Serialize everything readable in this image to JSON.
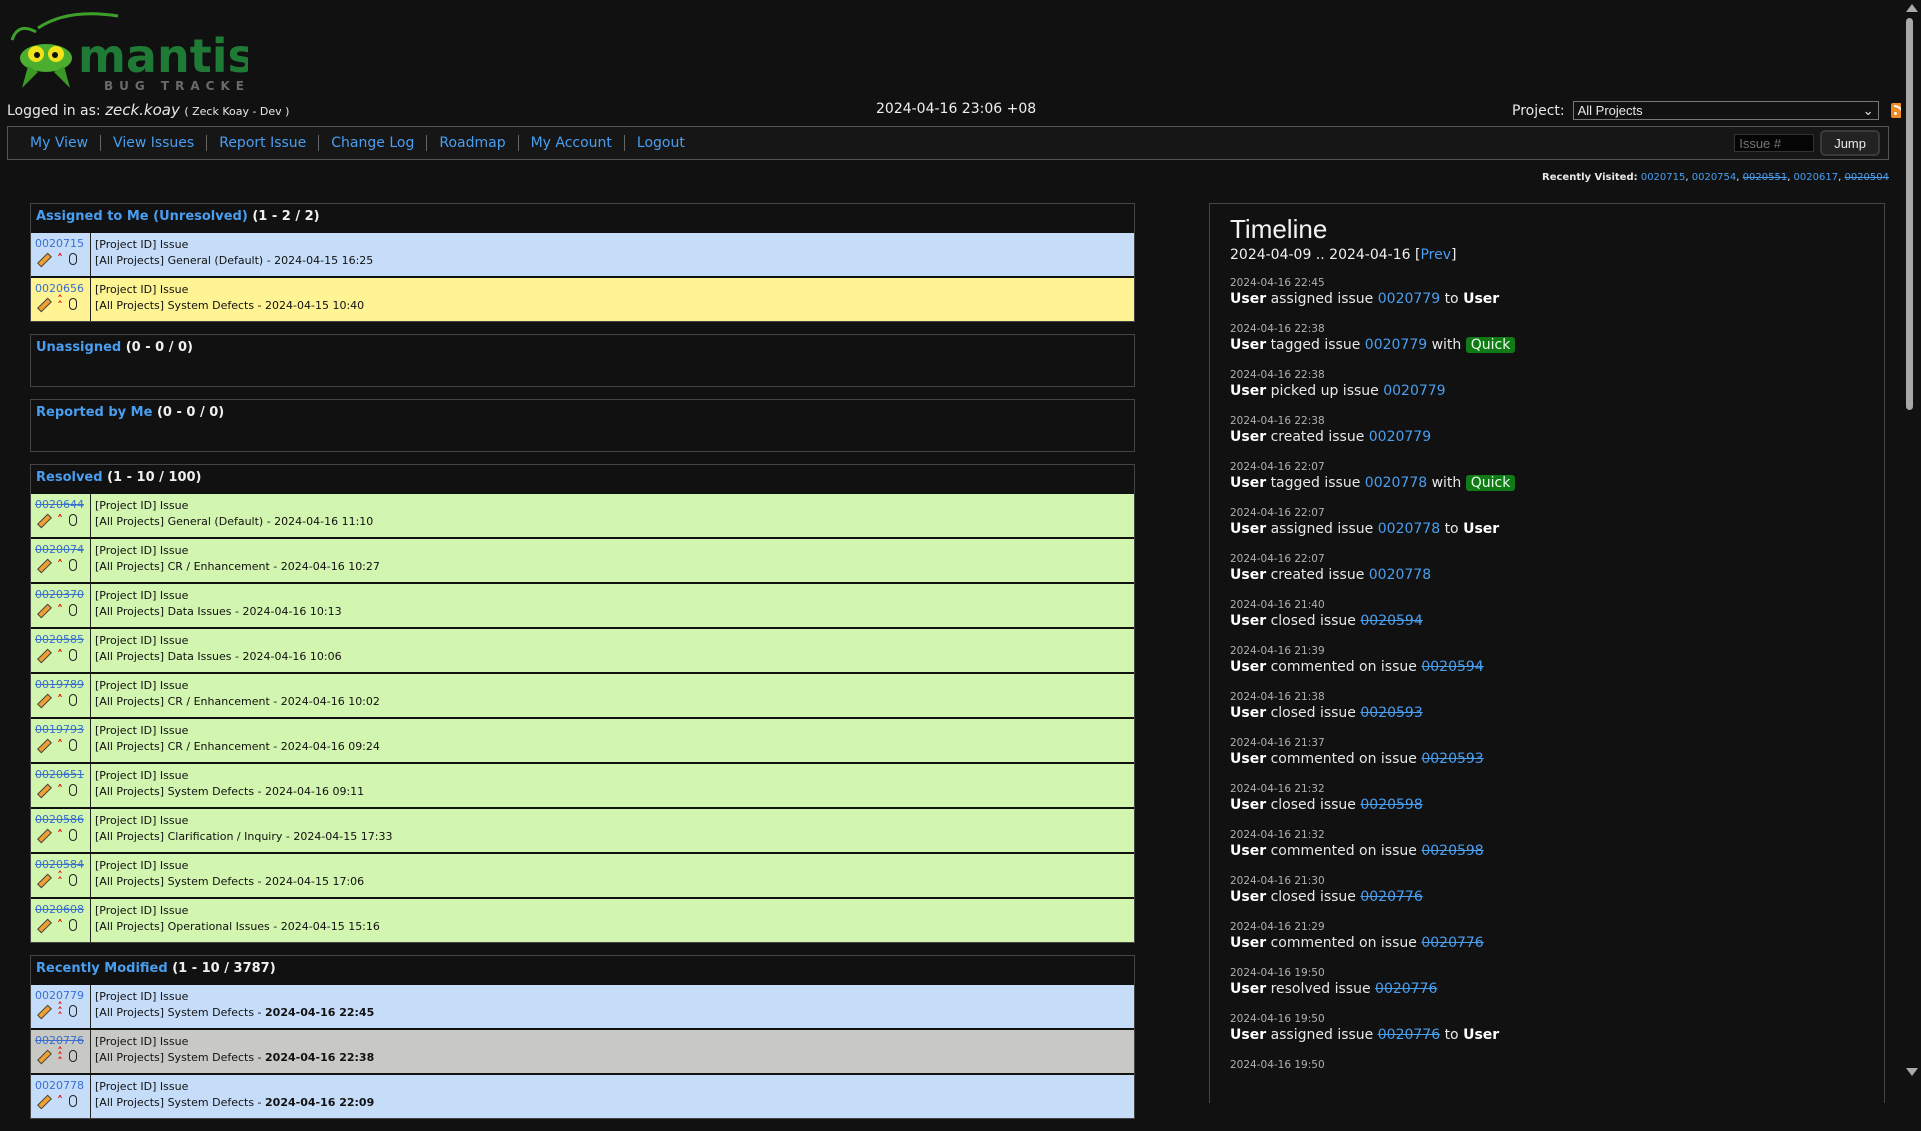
{
  "header": {
    "logo_title": "mantis",
    "logo_subtitle": "BUG TRACKER",
    "logged_in_label": "Logged in as:",
    "username": "zeck.koay",
    "realname": "( Zeck Koay - Dev )",
    "server_time": "2024-04-16 23:06 +08",
    "project_label": "Project:",
    "project_selected": "All Projects"
  },
  "nav": {
    "items": [
      "My View",
      "View Issues",
      "Report Issue",
      "Change Log",
      "Roadmap",
      "My Account",
      "Logout"
    ],
    "issue_placeholder": "Issue #",
    "jump_label": "Jump"
  },
  "recently_visited": {
    "label": "Recently Visited:",
    "items": [
      {
        "id": "0020715",
        "closed": false
      },
      {
        "id": "0020754",
        "closed": false
      },
      {
        "id": "0020551",
        "closed": true
      },
      {
        "id": "0020617",
        "closed": false
      },
      {
        "id": "0020504",
        "closed": true
      }
    ]
  },
  "boxes": [
    {
      "title": "Assigned to Me (Unresolved)",
      "count": "(1 - 2 / 2)",
      "rows": [
        {
          "id": "0020715",
          "closed": false,
          "priority": "high",
          "summary": "[Project ID] Issue",
          "meta": "[All Projects] General (Default) - ",
          "date": "2024-04-15 16:25",
          "bold": false,
          "color": "#c6ddfa"
        },
        {
          "id": "0020656",
          "closed": false,
          "priority": "urgent",
          "summary": "[Project ID] Issue",
          "meta": "[All Projects] System Defects - ",
          "date": "2024-04-15 10:40",
          "bold": false,
          "color": "#fff494"
        }
      ]
    },
    {
      "title": "Unassigned",
      "count": "(0 - 0 / 0)",
      "rows": []
    },
    {
      "title": "Reported by Me",
      "count": "(0 - 0 / 0)",
      "rows": []
    },
    {
      "title": "Resolved",
      "count": "(1 - 10 / 100)",
      "rows": [
        {
          "id": "0020644",
          "closed": true,
          "priority": "high",
          "summary": "[Project ID] Issue",
          "meta": "[All Projects] General (Default) - ",
          "date": "2024-04-16 11:10",
          "bold": false,
          "color": "#d2f5b0"
        },
        {
          "id": "0020074",
          "closed": true,
          "priority": "high",
          "summary": "[Project ID] Issue",
          "meta": "[All Projects] CR / Enhancement - ",
          "date": "2024-04-16 10:27",
          "bold": false,
          "color": "#d2f5b0"
        },
        {
          "id": "0020370",
          "closed": true,
          "priority": "high",
          "summary": "[Project ID] Issue",
          "meta": "[All Projects] Data Issues - ",
          "date": "2024-04-16 10:13",
          "bold": false,
          "color": "#d2f5b0"
        },
        {
          "id": "0020585",
          "closed": true,
          "priority": "high",
          "summary": "[Project ID] Issue",
          "meta": "[All Projects] Data Issues - ",
          "date": "2024-04-16 10:06",
          "bold": false,
          "color": "#d2f5b0"
        },
        {
          "id": "0019789",
          "closed": true,
          "priority": "high",
          "summary": "[Project ID] Issue",
          "meta": "[All Projects] CR / Enhancement - ",
          "date": "2024-04-16 10:02",
          "bold": false,
          "color": "#d2f5b0"
        },
        {
          "id": "0019793",
          "closed": true,
          "priority": "high",
          "summary": "[Project ID] Issue",
          "meta": "[All Projects] CR / Enhancement - ",
          "date": "2024-04-16 09:24",
          "bold": false,
          "color": "#d2f5b0"
        },
        {
          "id": "0020651",
          "closed": true,
          "priority": "high",
          "summary": "[Project ID] Issue",
          "meta": "[All Projects] System Defects - ",
          "date": "2024-04-16 09:11",
          "bold": false,
          "color": "#d2f5b0"
        },
        {
          "id": "0020586",
          "closed": true,
          "priority": "high",
          "summary": "[Project ID] Issue",
          "meta": "[All Projects] Clarification / Inquiry - ",
          "date": "2024-04-15 17:33",
          "bold": false,
          "color": "#d2f5b0"
        },
        {
          "id": "0020584",
          "closed": true,
          "priority": "urgent",
          "summary": "[Project ID] Issue",
          "meta": "[All Projects] System Defects - ",
          "date": "2024-04-15 17:06",
          "bold": false,
          "color": "#d2f5b0"
        },
        {
          "id": "0020608",
          "closed": true,
          "priority": "high",
          "summary": "[Project ID] Issue",
          "meta": "[All Projects] Operational Issues - ",
          "date": "2024-04-15 15:16",
          "bold": false,
          "color": "#d2f5b0"
        }
      ]
    },
    {
      "title": "Recently Modified",
      "count": "(1 - 10 / 3787)",
      "rows": [
        {
          "id": "0020779",
          "closed": false,
          "priority": "immediate",
          "summary": "[Project ID] Issue",
          "meta": "[All Projects] System Defects - ",
          "date": "2024-04-16 22:45",
          "bold": true,
          "color": "#c6ddfa"
        },
        {
          "id": "0020776",
          "closed": true,
          "priority": "immediate",
          "summary": "[Project ID] Issue",
          "meta": "[All Projects] System Defects - ",
          "date": "2024-04-16 22:38",
          "bold": true,
          "color": "#c8c8c4"
        },
        {
          "id": "0020778",
          "closed": false,
          "priority": "high",
          "summary": "[Project ID] Issue",
          "meta": "[All Projects] System Defects - ",
          "date": "2024-04-16 22:09",
          "bold": true,
          "color": "#c6ddfa"
        }
      ]
    }
  ],
  "timeline": {
    "title": "Timeline",
    "range": "2024-04-09 .. 2024-04-16",
    "prev_label": "Prev",
    "items": [
      {
        "date": "2024-04-16 22:45",
        "actor": "User",
        "verb": "assigned issue",
        "issue": "0020779",
        "closed": false,
        "suffix": "to",
        "target": "User",
        "tag": ""
      },
      {
        "date": "2024-04-16 22:38",
        "actor": "User",
        "verb": "tagged issue",
        "issue": "0020779",
        "closed": false,
        "suffix": "with",
        "target": "",
        "tag": "Quick"
      },
      {
        "date": "2024-04-16 22:38",
        "actor": "User",
        "verb": "picked up issue",
        "issue": "0020779",
        "closed": false,
        "suffix": "",
        "target": "",
        "tag": ""
      },
      {
        "date": "2024-04-16 22:38",
        "actor": "User",
        "verb": "created issue",
        "issue": "0020779",
        "closed": false,
        "suffix": "",
        "target": "",
        "tag": ""
      },
      {
        "date": "2024-04-16 22:07",
        "actor": "User",
        "verb": "tagged issue",
        "issue": "0020778",
        "closed": false,
        "suffix": "with",
        "target": "",
        "tag": "Quick"
      },
      {
        "date": "2024-04-16 22:07",
        "actor": "User",
        "verb": "assigned issue",
        "issue": "0020778",
        "closed": false,
        "suffix": "to",
        "target": "User",
        "tag": ""
      },
      {
        "date": "2024-04-16 22:07",
        "actor": "User",
        "verb": "created issue",
        "issue": "0020778",
        "closed": false,
        "suffix": "",
        "target": "",
        "tag": ""
      },
      {
        "date": "2024-04-16 21:40",
        "actor": "User",
        "verb": "closed issue",
        "issue": "0020594",
        "closed": true,
        "suffix": "",
        "target": "",
        "tag": ""
      },
      {
        "date": "2024-04-16 21:39",
        "actor": "User",
        "verb": "commented on issue",
        "issue": "0020594",
        "closed": true,
        "suffix": "",
        "target": "",
        "tag": ""
      },
      {
        "date": "2024-04-16 21:38",
        "actor": "User",
        "verb": "closed issue",
        "issue": "0020593",
        "closed": true,
        "suffix": "",
        "target": "",
        "tag": ""
      },
      {
        "date": "2024-04-16 21:37",
        "actor": "User",
        "verb": "commented on issue",
        "issue": "0020593",
        "closed": true,
        "suffix": "",
        "target": "",
        "tag": ""
      },
      {
        "date": "2024-04-16 21:32",
        "actor": "User",
        "verb": "closed issue",
        "issue": "0020598",
        "closed": true,
        "suffix": "",
        "target": "",
        "tag": ""
      },
      {
        "date": "2024-04-16 21:32",
        "actor": "User",
        "verb": "commented on issue",
        "issue": "0020598",
        "closed": true,
        "suffix": "",
        "target": "",
        "tag": ""
      },
      {
        "date": "2024-04-16 21:30",
        "actor": "User",
        "verb": "closed issue",
        "issue": "0020776",
        "closed": true,
        "suffix": "",
        "target": "",
        "tag": ""
      },
      {
        "date": "2024-04-16 21:29",
        "actor": "User",
        "verb": "commented on issue",
        "issue": "0020776",
        "closed": true,
        "suffix": "",
        "target": "",
        "tag": ""
      },
      {
        "date": "2024-04-16 19:50",
        "actor": "User",
        "verb": "resolved issue",
        "issue": "0020776",
        "closed": true,
        "suffix": "",
        "target": "",
        "tag": ""
      },
      {
        "date": "2024-04-16 19:50",
        "actor": "User",
        "verb": "assigned issue",
        "issue": "0020776",
        "closed": true,
        "suffix": "to",
        "target": "User",
        "tag": ""
      },
      {
        "date": "2024-04-16 19:50",
        "actor": "",
        "verb": "",
        "issue": "",
        "closed": false,
        "suffix": "",
        "target": "",
        "tag": ""
      }
    ]
  },
  "colors": {
    "link": "#4a9ef0",
    "row_assigned": "#c6ddfa",
    "row_feedback": "#fff494",
    "row_resolved": "#d2f5b0",
    "row_closed": "#c8c8c4",
    "tag": "#0f7a16",
    "priority": "#e00000"
  }
}
